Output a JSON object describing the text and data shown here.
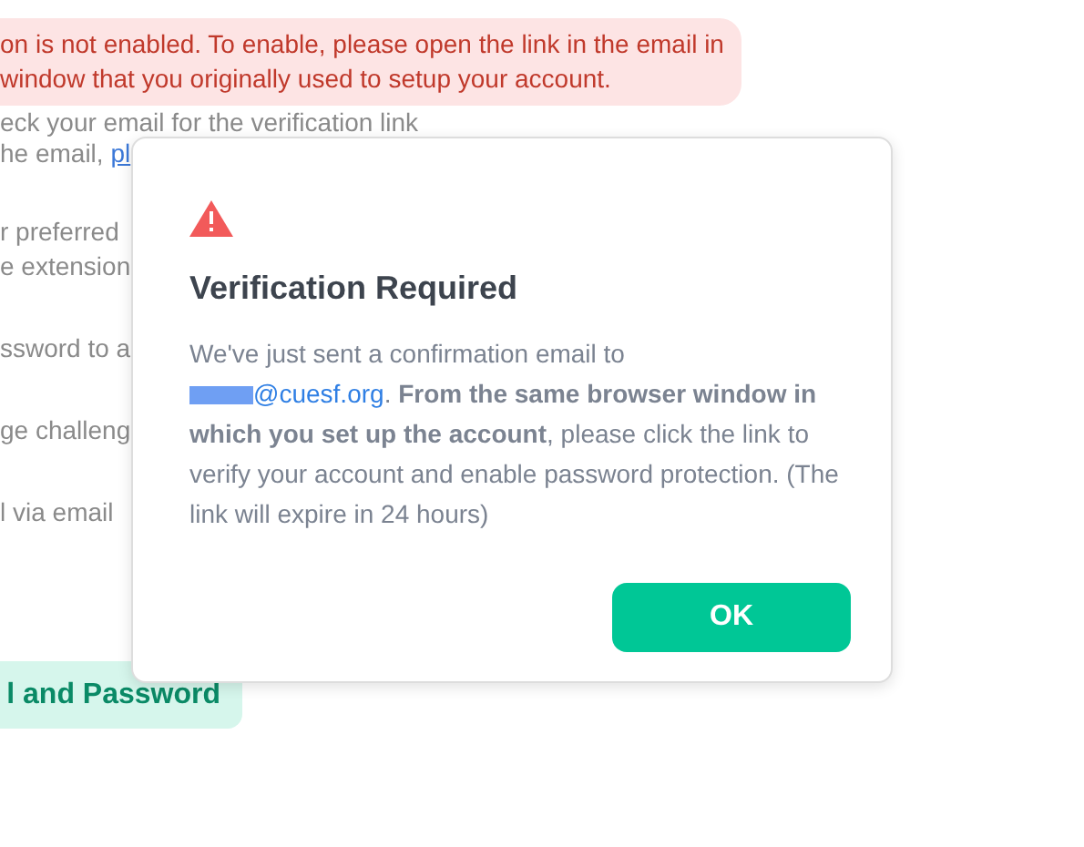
{
  "background": {
    "banner": {
      "lines": [
        "on is not enabled. To enable, please open the link in the email in",
        "window that you originally used to setup your account."
      ]
    },
    "check_line": "eck your email for the verification link",
    "resend_line": {
      "text": "he email, ",
      "link": "pl"
    },
    "fragments": [
      {
        "lines": [
          "r preferred",
          "e extension"
        ]
      },
      {
        "lines": [
          "ssword to a"
        ]
      },
      {
        "lines": [
          "ge challeng"
        ]
      },
      {
        "lines": [
          "l via email"
        ]
      }
    ],
    "button": "l and Password"
  },
  "dialog": {
    "title": "Verification Required",
    "body": {
      "intro": "We've just sent a confirmation email to",
      "email": "@cuesf.org",
      "rest": ". **From the same browser window in which you set up the account**, please click the link to verify your account and enable password protection. (The link will expire in 24 hours)"
    },
    "ok_button": "OK"
  }
}
